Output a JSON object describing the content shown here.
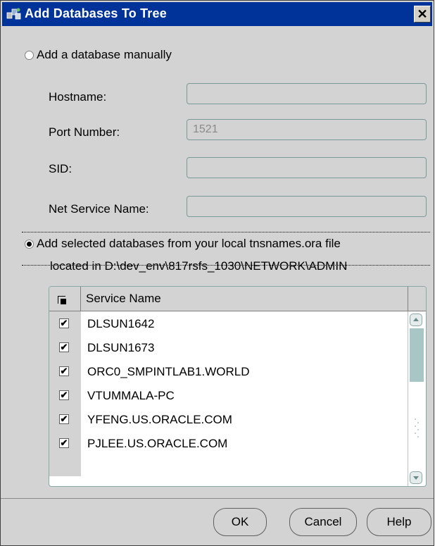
{
  "window": {
    "title": "Add Databases To Tree",
    "close_glyph": "✕"
  },
  "manual": {
    "radio_label": "Add a database manually",
    "hostname_label": "Hostname:",
    "hostname_value": "",
    "port_label": "Port Number:",
    "port_value": "1521",
    "sid_label": "SID:",
    "sid_value": "",
    "netservice_label": "Net Service Name:",
    "netservice_value": ""
  },
  "tnsnames": {
    "radio_label": "Add selected databases from your local tnsnames.ora file",
    "located_text": "located in D:\\dev_env\\817rsfs_1030\\NETWORK\\ADMIN",
    "column_header": "Service Name",
    "rows": [
      {
        "name": "DLSUN1642",
        "checked": true
      },
      {
        "name": "DLSUN1673",
        "checked": true
      },
      {
        "name": "ORC0_SMPINTLAB1.WORLD",
        "checked": true
      },
      {
        "name": "VTUMMALA-PC",
        "checked": true
      },
      {
        "name": "YFENG.US.ORACLE.COM",
        "checked": true
      },
      {
        "name": "PJLEE.US.ORACLE.COM",
        "checked": true
      }
    ]
  },
  "buttons": {
    "ok": "OK",
    "cancel": "Cancel",
    "help": "Help"
  },
  "icons": {
    "app": "databases-tree-icon",
    "close": "close-icon",
    "check": "checkmark-icon"
  },
  "colors": {
    "titlebar": "#003399",
    "dialog": "#d3d3d3",
    "scroll_thumb": "#a9c6c6"
  }
}
